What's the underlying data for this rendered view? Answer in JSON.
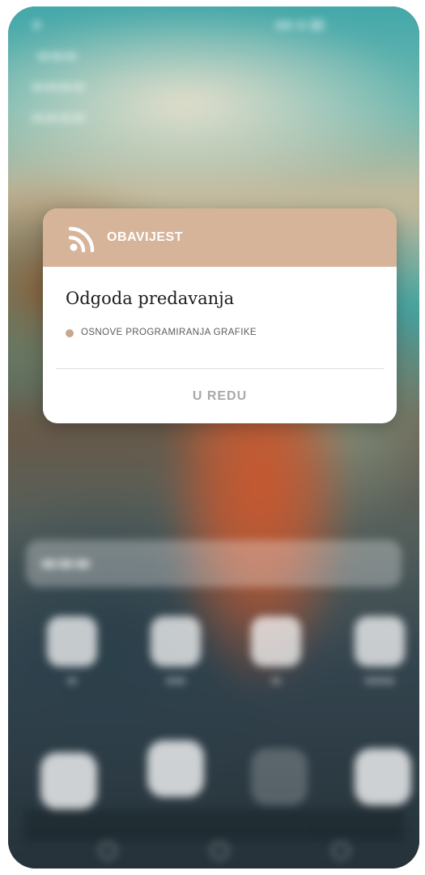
{
  "dialog": {
    "header_label": "OBAVIJEST",
    "title": "Odgoda predavanja",
    "course_name": "OSNOVE PROGRAMIRANJA GRAFIKE",
    "ok_label": "U REDU",
    "header_color": "#d6b49a",
    "course_dot_color": "#c9a78e",
    "icon": "rss-icon"
  }
}
